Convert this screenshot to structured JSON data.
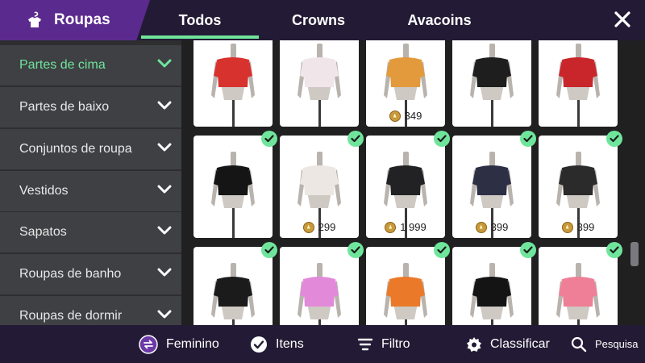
{
  "header": {
    "brand_label": "Roupas",
    "tabs": [
      {
        "label": "Todos",
        "active": true
      },
      {
        "label": "Crowns",
        "active": false
      },
      {
        "label": "Avacoins",
        "active": false
      }
    ]
  },
  "sidebar": {
    "categories": [
      {
        "label": "Partes de cima",
        "active": true
      },
      {
        "label": "Partes de baixo",
        "active": false
      },
      {
        "label": "Conjuntos de roupa",
        "active": false
      },
      {
        "label": "Vestidos",
        "active": false
      },
      {
        "label": "Sapatos",
        "active": false
      },
      {
        "label": "Roupas de banho",
        "active": false
      },
      {
        "label": "Roupas de dormir",
        "active": false
      }
    ]
  },
  "items": {
    "row1": [
      {
        "color": "#d8322e",
        "price": null,
        "checked": false
      },
      {
        "color": "#f0e6ea",
        "price": null,
        "checked": false
      },
      {
        "color": "#e39a3c",
        "price": "349",
        "checked": false
      },
      {
        "color": "#1e1e1e",
        "price": null,
        "checked": false
      },
      {
        "color": "#c8262b",
        "price": null,
        "checked": false
      }
    ],
    "row2": [
      {
        "color": "#151515",
        "price": null,
        "checked": true
      },
      {
        "color": "#ece7e2",
        "price": "299",
        "checked": true
      },
      {
        "color": "#222224",
        "price": "1 999",
        "checked": true
      },
      {
        "color": "#2d2f45",
        "price": "399",
        "checked": true
      },
      {
        "color": "#2b2b2b",
        "price": "399",
        "checked": true
      }
    ],
    "row3": [
      {
        "color": "#1b1b1b",
        "price": null,
        "checked": true
      },
      {
        "color": "#e28ad9",
        "price": null,
        "checked": true
      },
      {
        "color": "#ea7a2a",
        "price": null,
        "checked": true
      },
      {
        "color": "#141414",
        "price": null,
        "checked": true
      },
      {
        "color": "#ee7f96",
        "price": null,
        "checked": true
      }
    ]
  },
  "bottombar": {
    "gender_label": "Feminino",
    "items_label": "Itens",
    "filter_label": "Filtro",
    "sort_label": "Classificar",
    "search_label": "Pesquisa"
  },
  "colors": {
    "accent": "#6fe59c",
    "brand": "#5b2a8e",
    "bar": "#231b35"
  }
}
